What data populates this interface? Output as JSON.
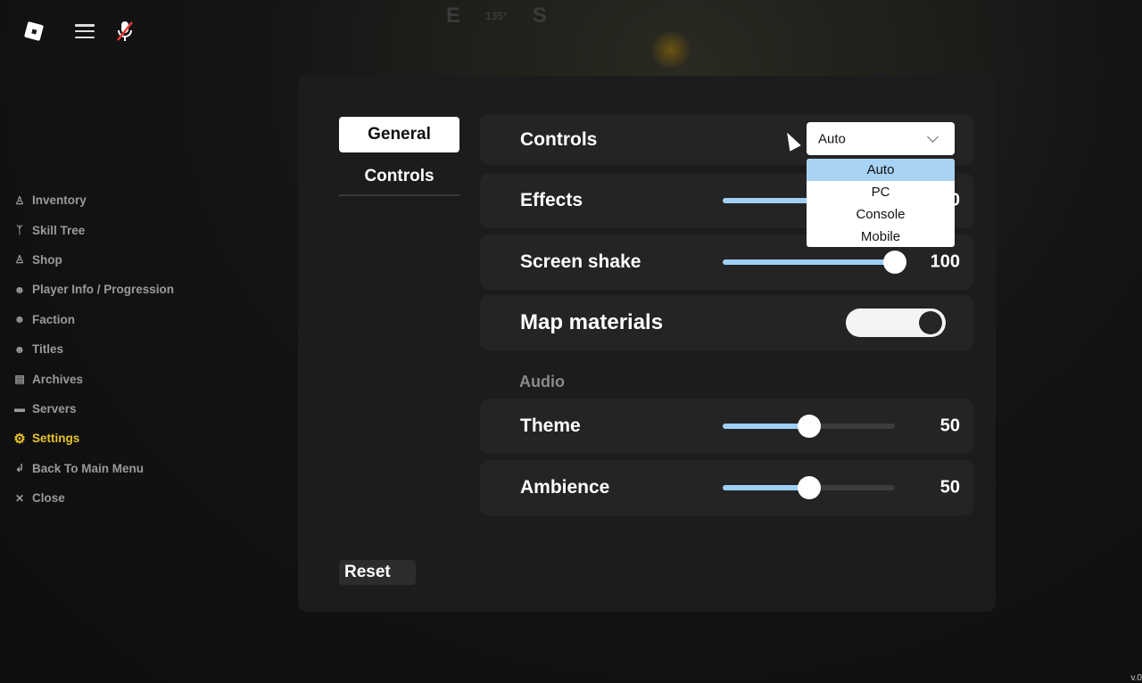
{
  "topbar": {
    "logo_icon": "roblox-logo-icon",
    "menu_icon": "hamburger-icon",
    "mic_icon": "microphone-muted-icon"
  },
  "compass": [
    "E",
    "135°",
    "S"
  ],
  "sidebar": {
    "items": [
      {
        "label": "Inventory",
        "icon": "backpack-icon",
        "glyph": "♙"
      },
      {
        "label": "Skill Tree",
        "icon": "tree-icon",
        "glyph": "ᛉ"
      },
      {
        "label": "Shop",
        "icon": "bag-icon",
        "glyph": "♙"
      },
      {
        "label": "Player Info / Progression",
        "icon": "user-icon",
        "glyph": "☻"
      },
      {
        "label": "Faction",
        "icon": "group-icon",
        "glyph": "☻"
      },
      {
        "label": "Titles",
        "icon": "user-badge-icon",
        "glyph": "☻"
      },
      {
        "label": "Archives",
        "icon": "books-icon",
        "glyph": "▤"
      },
      {
        "label": "Servers",
        "icon": "server-icon",
        "glyph": "▬"
      },
      {
        "label": "Settings",
        "icon": "gear-icon",
        "glyph": "⚙",
        "active": true
      },
      {
        "label": "Back To Main Menu",
        "icon": "return-arrow-icon",
        "glyph": "↲"
      },
      {
        "label": "Close",
        "icon": "close-icon",
        "glyph": "✕"
      }
    ],
    "active_color": "#e8c22a"
  },
  "tabs": {
    "general": "General",
    "controls": "Controls"
  },
  "settings": {
    "controls": {
      "label": "Controls",
      "selected": "Auto",
      "options": [
        "Auto",
        "PC",
        "Console",
        "Mobile"
      ]
    },
    "effects": {
      "label": "Effects",
      "value": "100",
      "level": 100
    },
    "screen_shake": {
      "label": "Screen shake",
      "value": "100",
      "level": 100
    },
    "map_materials": {
      "label": "Map materials",
      "enabled": true
    },
    "audio_heading": "Audio",
    "theme": {
      "label": "Theme",
      "value": "50",
      "level": 50
    },
    "ambience": {
      "label": "Ambience",
      "value": "50",
      "level": 50
    }
  },
  "reset_label": "Reset",
  "version": "v.0",
  "colors": {
    "slider_fill": "#9ecff5",
    "dropdown_selected": "#a9d3f5"
  }
}
